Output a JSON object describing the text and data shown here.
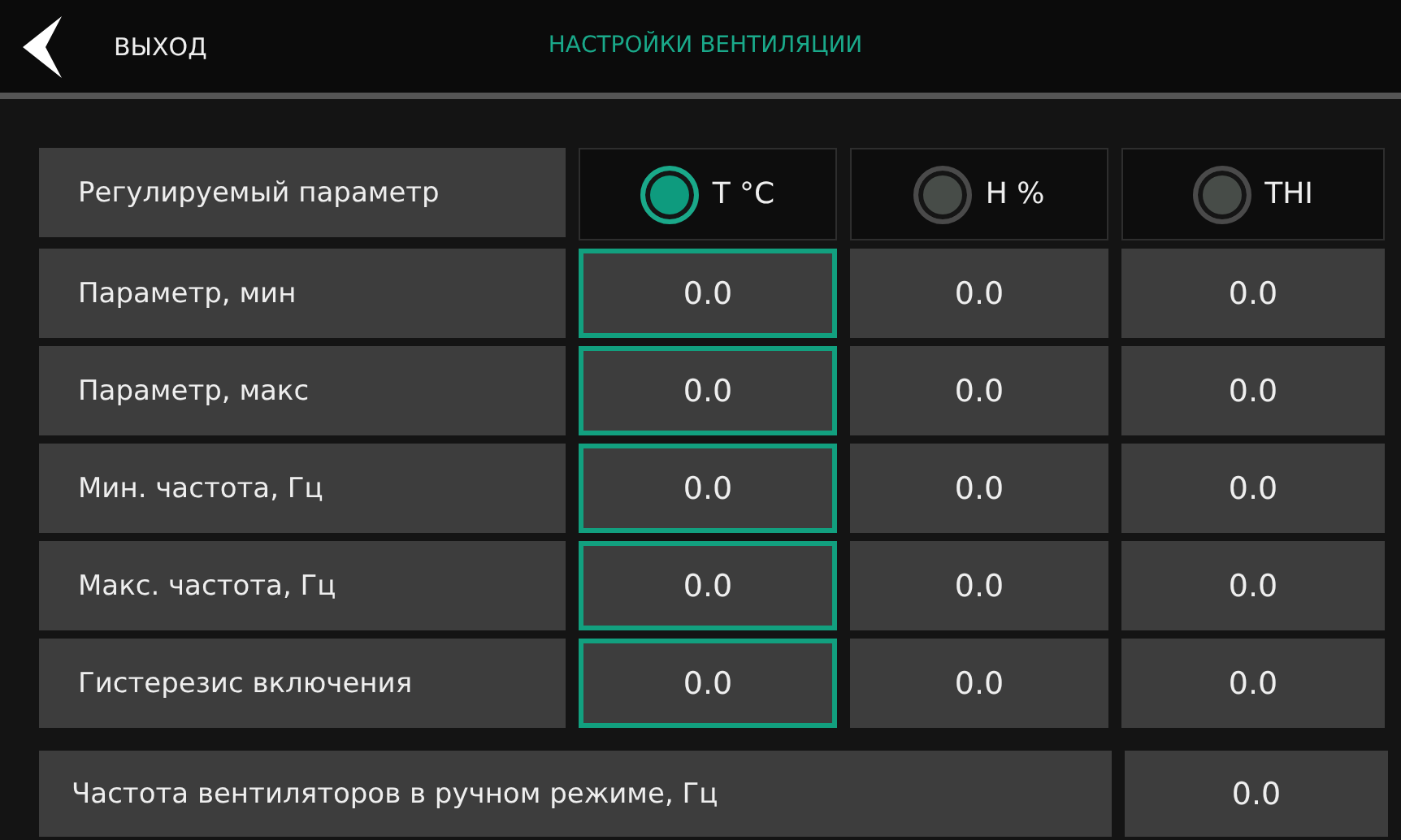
{
  "header": {
    "back_label": "ВЫХОД",
    "title": "НАСТРОЙКИ ВЕНТИЛЯЦИИ"
  },
  "mode_label": "Регулируемый параметр",
  "modes": [
    {
      "label": "T °C",
      "selected": true
    },
    {
      "label": "H %",
      "selected": false
    },
    {
      "label": "THI",
      "selected": false
    }
  ],
  "rows": [
    {
      "label": "Параметр, мин",
      "values": [
        "0.0",
        "0.0",
        "0.0"
      ]
    },
    {
      "label": "Параметр, макс",
      "values": [
        "0.0",
        "0.0",
        "0.0"
      ]
    },
    {
      "label": "Мин. частота, Гц",
      "values": [
        "0.0",
        "0.0",
        "0.0"
      ]
    },
    {
      "label": "Макс. частота, Гц",
      "values": [
        "0.0",
        "0.0",
        "0.0"
      ]
    },
    {
      "label": "Гистерезис включения",
      "values": [
        "0.0",
        "0.0",
        "0.0"
      ]
    }
  ],
  "manual": {
    "label": "Частота вентиляторов в ручном режиме, Гц",
    "value": "0.0"
  }
}
